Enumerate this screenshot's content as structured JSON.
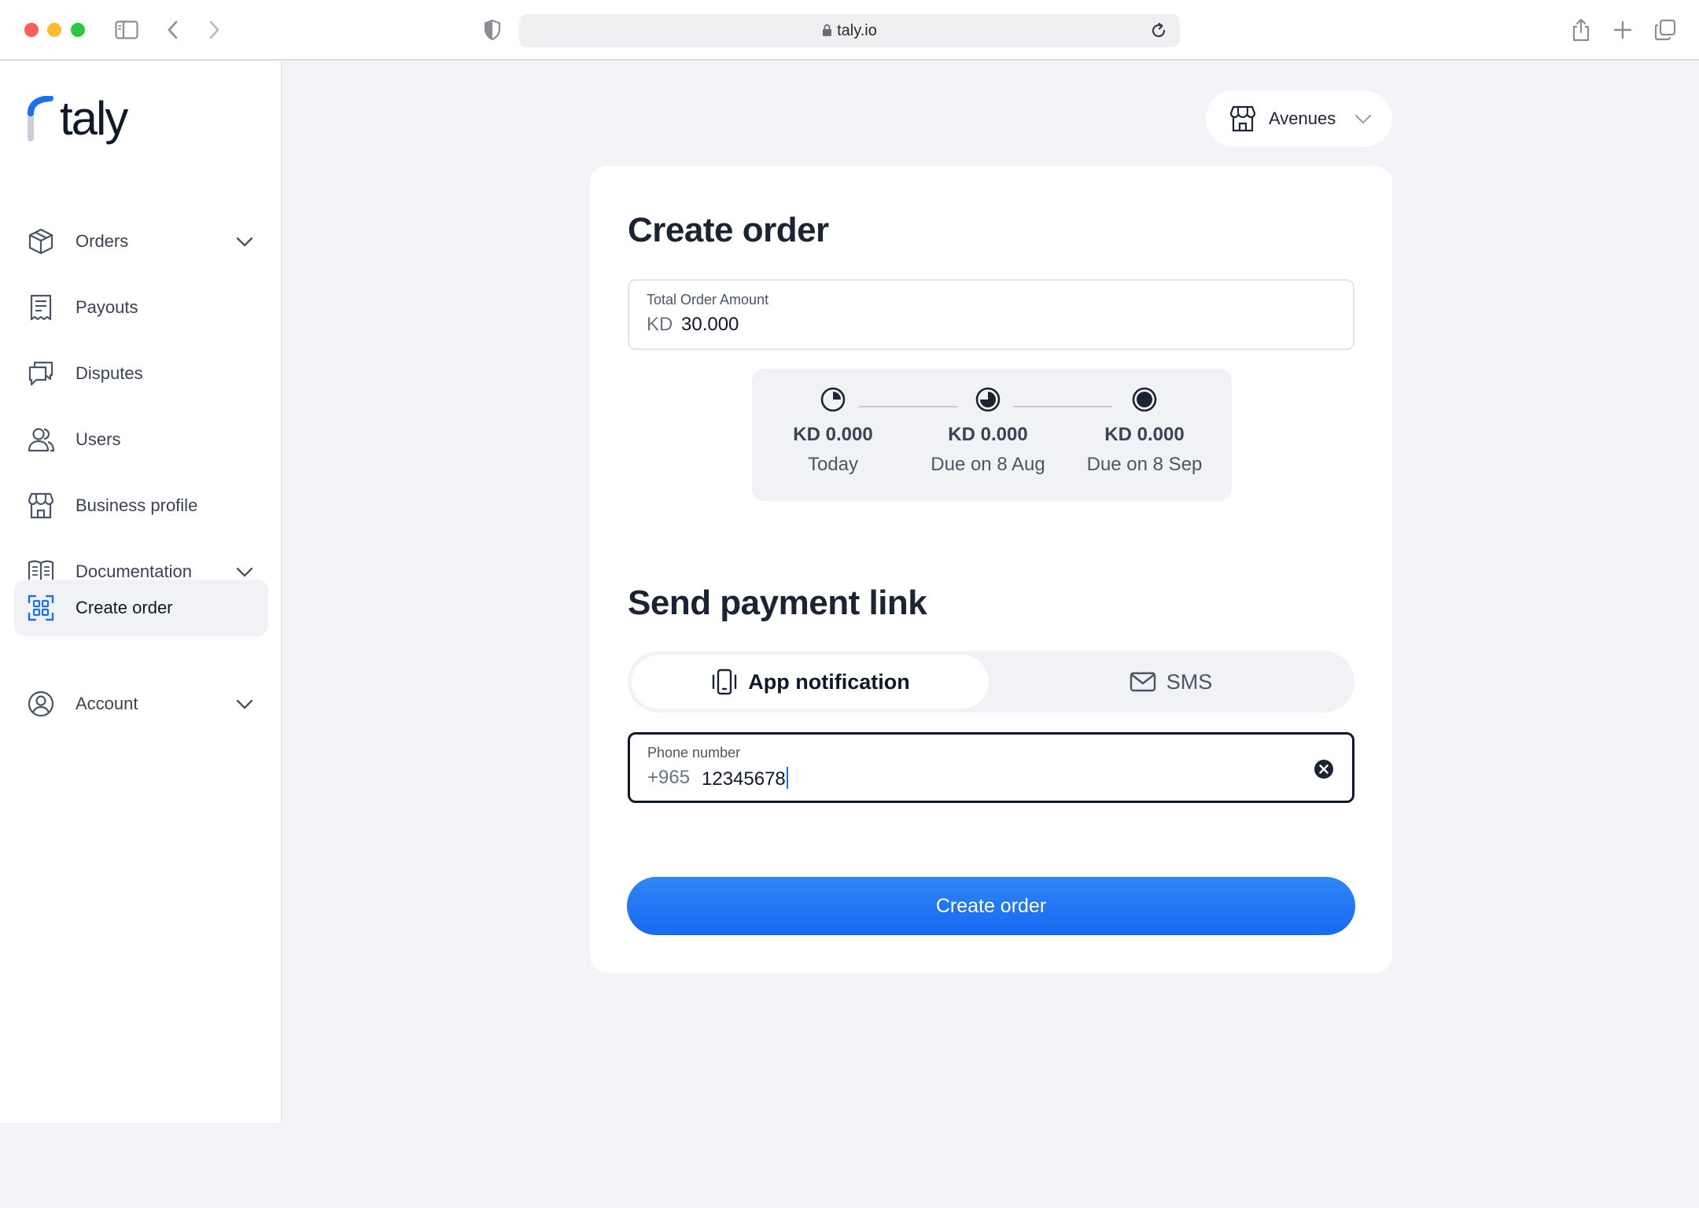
{
  "browser": {
    "url": "taly.io"
  },
  "brand": {
    "name": "taly",
    "accent": "#1d6ff2"
  },
  "sidebar": {
    "items": [
      {
        "label": "Orders",
        "icon": "box-icon",
        "expandable": true
      },
      {
        "label": "Payouts",
        "icon": "receipt-icon",
        "expandable": false
      },
      {
        "label": "Disputes",
        "icon": "chat-bubbles-icon",
        "expandable": false
      },
      {
        "label": "Users",
        "icon": "users-icon",
        "expandable": false
      },
      {
        "label": "Business profile",
        "icon": "storefront-icon",
        "expandable": false
      },
      {
        "label": "Documentation",
        "icon": "book-icon",
        "expandable": true
      },
      {
        "label": "Create order",
        "icon": "qr-scan-icon",
        "expandable": false,
        "active": true
      },
      {
        "label": "Account",
        "icon": "user-circle-icon",
        "expandable": true
      }
    ]
  },
  "store": {
    "label": "Avenues",
    "icon": "storefront-icon"
  },
  "create_order": {
    "title": "Create order",
    "amount": {
      "label": "Total Order Amount",
      "currency": "KD",
      "value": "30.000"
    },
    "installments": [
      {
        "amount": "KD 0.000",
        "date": "Today",
        "icon": "pie-quarter-icon"
      },
      {
        "amount": "KD 0.000",
        "date": "Due on 8 Aug",
        "icon": "pie-three-quarter-icon"
      },
      {
        "amount": "KD 0.000",
        "date": "Due on 8 Sep",
        "icon": "pie-full-icon"
      }
    ]
  },
  "payment_link": {
    "title": "Send payment link",
    "options": [
      {
        "label": "App notification",
        "icon": "phone-vibrate-icon",
        "selected": true
      },
      {
        "label": "SMS",
        "icon": "envelope-icon",
        "selected": false
      }
    ],
    "phone": {
      "label": "Phone number",
      "prefix": "+965",
      "value": "12345678"
    }
  },
  "cta": {
    "label": "Create order"
  }
}
